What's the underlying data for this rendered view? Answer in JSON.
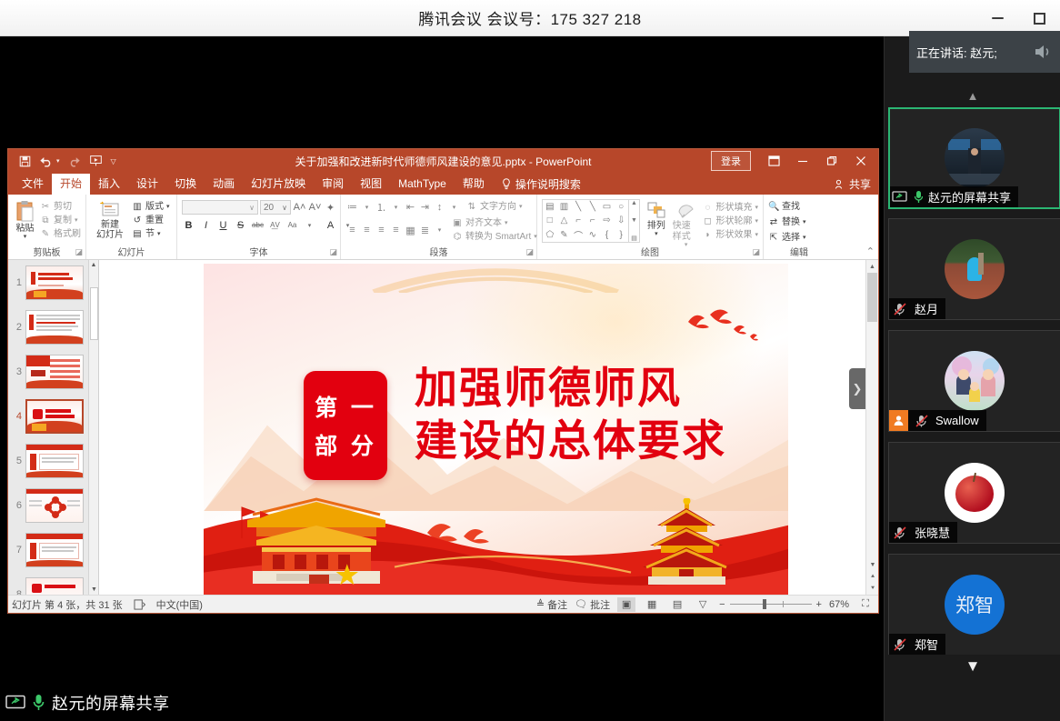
{
  "meeting": {
    "title": "腾讯会议 会议号：175 327 218",
    "minimize_label": "最小化",
    "maximize_label": "最大化",
    "speaking_toast": "正在讲话: 赵元;",
    "share_status": "赵元的屏幕共享",
    "scroll_up_label": "向上",
    "scroll_down_label": "向下"
  },
  "participants": [
    {
      "name": "赵元的屏幕共享",
      "muted": false,
      "speaking": true,
      "host": false,
      "sharing": true,
      "avatar_type": "photo-conference"
    },
    {
      "name": "赵月",
      "muted": true,
      "speaking": false,
      "host": false,
      "sharing": false,
      "avatar_type": "photo-rain"
    },
    {
      "name": "Swallow",
      "muted": true,
      "speaking": false,
      "host": true,
      "sharing": false,
      "avatar_type": "cartoon-family"
    },
    {
      "name": "张晓慧",
      "muted": true,
      "speaking": false,
      "host": false,
      "sharing": false,
      "avatar_type": "photo-apple"
    },
    {
      "name": "郑智",
      "muted": true,
      "speaking": false,
      "host": false,
      "sharing": false,
      "avatar_type": "initials-blue",
      "avatar_text": "郑智"
    }
  ],
  "powerpoint": {
    "document_title": "关于加强和改进新时代师德师风建设的意见.pptx  -  PowerPoint",
    "signin_label": "登录",
    "share_label": "共享",
    "tell_me_placeholder": "操作说明搜索",
    "ribbon_display_label": "功能区显示选项",
    "minimize_label": "最小化",
    "restore_label": "向下还原",
    "close_label": "关闭",
    "collapse_ribbon_label": "折叠功能区",
    "quick_access": [
      "保存",
      "撤消",
      "重复",
      "从头开始",
      "自定义快速访问工具栏"
    ],
    "tabs": [
      {
        "label": "文件",
        "active": false
      },
      {
        "label": "开始",
        "active": true
      },
      {
        "label": "插入",
        "active": false
      },
      {
        "label": "设计",
        "active": false
      },
      {
        "label": "切换",
        "active": false
      },
      {
        "label": "动画",
        "active": false
      },
      {
        "label": "幻灯片放映",
        "active": false
      },
      {
        "label": "审阅",
        "active": false
      },
      {
        "label": "视图",
        "active": false
      },
      {
        "label": "MathType",
        "active": false
      },
      {
        "label": "帮助",
        "active": false
      }
    ],
    "groups": {
      "clipboard": {
        "title": "剪贴板",
        "paste": "粘贴",
        "items": [
          "剪切",
          "复制",
          "格式刷"
        ]
      },
      "slides": {
        "title": "幻灯片",
        "new_slide": "新建\n幻灯片",
        "new_slide_l1": "新建",
        "new_slide_l2": "幻灯片",
        "items": [
          "版式",
          "重置",
          "节"
        ]
      },
      "font": {
        "title": "字体",
        "font_name": "",
        "font_size": "20",
        "buttons": [
          "B",
          "I",
          "U",
          "S",
          "abc",
          "AV",
          "A"
        ]
      },
      "paragraph": {
        "title": "段落",
        "items": [
          "文字方向",
          "对齐文本",
          "转换为 SmartArt"
        ]
      },
      "drawing": {
        "title": "绘图",
        "arrange": "排列",
        "quick_styles": "快速样式",
        "items": [
          "形状填充",
          "形状轮廓",
          "形状效果"
        ]
      },
      "editing": {
        "title": "编辑",
        "items": [
          "查找",
          "替换",
          "选择"
        ]
      }
    },
    "thumbnails": [
      {
        "number": "1",
        "selected": false
      },
      {
        "number": "2",
        "selected": false
      },
      {
        "number": "3",
        "selected": false
      },
      {
        "number": "4",
        "selected": true
      },
      {
        "number": "5",
        "selected": false
      },
      {
        "number": "6",
        "selected": false
      },
      {
        "number": "7",
        "selected": false
      },
      {
        "number": "8",
        "selected": false
      }
    ],
    "slide": {
      "badge_line1": "第 一",
      "badge_line2": "部 分",
      "title_line1": "加强师德师风",
      "title_line2": "建设的总体要求",
      "accent_color": "#e60012",
      "title_color": "#e2000f"
    },
    "status": {
      "slide_count": "幻灯片 第 4 张，共 31 张",
      "language": "中文(中国)",
      "notes": "备注",
      "comments": "批注",
      "views": [
        "普通视图",
        "幻灯片浏览",
        "阅读视图",
        "幻灯片放映"
      ],
      "zoom_out": "缩小",
      "zoom_in": "放大",
      "zoom_level": "67%",
      "fit_label": "使幻灯片适应当前窗口"
    }
  }
}
